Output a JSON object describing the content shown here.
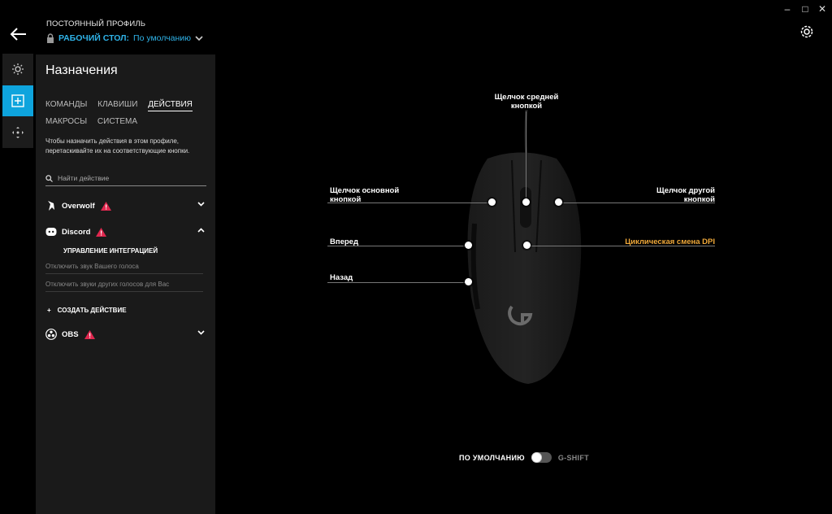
{
  "window": {
    "minimize": "–",
    "maximize": "□",
    "close": "✕"
  },
  "profile": {
    "label": "ПОСТОЯННЫЙ ПРОФИЛЬ",
    "name": "РАБОЧИЙ СТОЛ:",
    "value": "По умолчанию"
  },
  "panel": {
    "title": "Назначения",
    "tabs": [
      "КОМАНДЫ",
      "КЛАВИШИ",
      "ДЕЙСТВИЯ",
      "МАКРОСЫ",
      "СИСТЕМА"
    ],
    "active_tab": "ДЕЙСТВИЯ",
    "description": "Чтобы назначить действия в этом профиле, перетаскивайте их на соответствующие кнопки.",
    "search_placeholder": "Найти действие",
    "groups": {
      "overwolf": "Overwolf",
      "discord": "Discord",
      "obs": "OBS"
    },
    "discord_section_title": "УПРАВЛЕНИЕ ИНТЕГРАЦИЕЙ",
    "discord_items": [
      "Отключить звук Вашего голоса",
      "Отключить звуки других голосов для Вас"
    ],
    "create_action": "СОЗДАТЬ ДЕЙСТВИЕ"
  },
  "callouts": {
    "middle": "Щелчок средней кнопкой",
    "primary": "Щелчок основной кнопкой",
    "secondary": "Щелчок другой кнопкой",
    "forward": "Вперед",
    "back": "Назад",
    "dpi": "Циклическая смена DPI"
  },
  "toggle": {
    "left_label": "ПО УМОЛЧАНИЮ",
    "right_label": "G-SHIFT"
  },
  "colors": {
    "accent": "#0ea4dd",
    "profile_text": "#2fb3e8",
    "dpi_label": "#f0a93a",
    "warning": "#e0284f"
  }
}
